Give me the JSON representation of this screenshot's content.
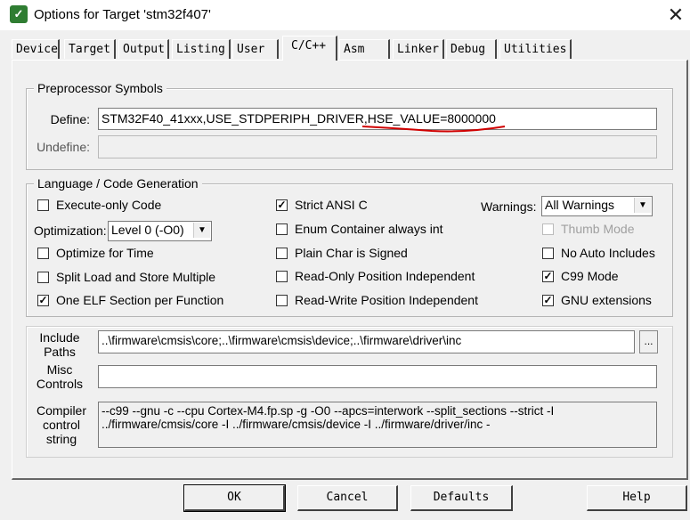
{
  "window": {
    "title": "Options for Target 'stm32f407'",
    "icon": "keil-icon",
    "close_glyph": "✕"
  },
  "tabs": [
    {
      "label": "Device",
      "active": false
    },
    {
      "label": "Target",
      "active": false
    },
    {
      "label": "Output",
      "active": false
    },
    {
      "label": "Listing",
      "active": false
    },
    {
      "label": "User",
      "active": false
    },
    {
      "label": "C/C++",
      "active": true
    },
    {
      "label": "Asm",
      "active": false
    },
    {
      "label": "Linker",
      "active": false
    },
    {
      "label": "Debug",
      "active": false
    },
    {
      "label": "Utilities",
      "active": false
    }
  ],
  "preprocessor": {
    "legend": "Preprocessor Symbols",
    "define_label": "Define:",
    "define_value": "STM32F40_41xxx,USE_STDPERIPH_DRIVER,HSE_VALUE=8000000",
    "undefine_label": "Undefine:",
    "undefine_value": ""
  },
  "codegen": {
    "legend": "Language / Code Generation",
    "execute_only": {
      "label": "Execute-only Code",
      "checked": false
    },
    "optimization_label": "Optimization:",
    "optimization_value": "Level 0 (-O0)",
    "optimize_time": {
      "label": "Optimize for Time",
      "checked": false
    },
    "split_load": {
      "label": "Split Load and Store Multiple",
      "checked": false
    },
    "one_elf": {
      "label": "One ELF Section per Function",
      "checked": true
    },
    "strict_ansi": {
      "label": "Strict ANSI C",
      "checked": true
    },
    "enum_container": {
      "label": "Enum Container always int",
      "checked": false
    },
    "plain_char": {
      "label": "Plain Char is Signed",
      "checked": false
    },
    "ro_pos": {
      "label": "Read-Only Position Independent",
      "checked": false
    },
    "rw_pos": {
      "label": "Read-Write Position Independent",
      "checked": false
    },
    "warnings_label": "Warnings:",
    "warnings_value": "All Warnings",
    "thumb_mode": {
      "label": "Thumb Mode",
      "checked": false,
      "disabled": true
    },
    "no_auto_includes": {
      "label": "No Auto Includes",
      "checked": false
    },
    "c99_mode": {
      "label": "C99 Mode",
      "checked": true
    },
    "gnu_ext": {
      "label": "GNU extensions",
      "checked": true
    }
  },
  "paths": {
    "include_label_1": "Include",
    "include_label_2": "Paths",
    "include_value": "..\\firmware\\cmsis\\core;..\\firmware\\cmsis\\device;..\\firmware\\driver\\inc",
    "browse_label": "...",
    "misc_label_1": "Misc",
    "misc_label_2": "Controls",
    "misc_value": "",
    "compiler_label_1": "Compiler",
    "compiler_label_2": "control",
    "compiler_label_3": "string",
    "compiler_value": "--c99 --gnu -c --cpu Cortex-M4.fp.sp -g -O0 --apcs=interwork --split_sections --strict -I ../firmware/cmsis/core -I ../firmware/cmsis/device -I ../firmware/driver/inc -"
  },
  "buttons": {
    "ok": "OK",
    "cancel": "Cancel",
    "defaults": "Defaults",
    "help": "Help"
  },
  "colors": {
    "annotation_red": "#d00000"
  }
}
